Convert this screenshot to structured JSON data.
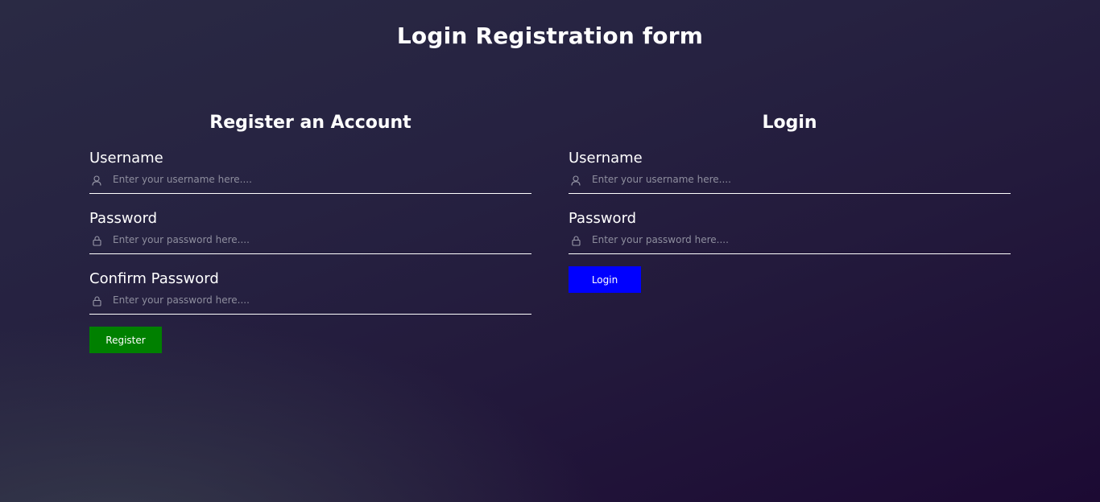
{
  "page": {
    "title": "Login Registration form"
  },
  "register": {
    "title": "Register an Account",
    "username_label": "Username",
    "username_placeholder": "Enter your username here....",
    "password_label": "Password",
    "password_placeholder": "Enter your password here....",
    "confirm_label": "Confirm Password",
    "confirm_placeholder": "Enter your password here....",
    "button_label": "Register",
    "button_color": "#008000"
  },
  "login": {
    "title": "Login",
    "username_label": "Username",
    "username_placeholder": "Enter your username here....",
    "password_label": "Password",
    "password_placeholder": "Enter your password here....",
    "button_label": "Login",
    "button_color": "#0000ff"
  },
  "icons": {
    "username": "user-icon",
    "password": "lock-icon"
  }
}
